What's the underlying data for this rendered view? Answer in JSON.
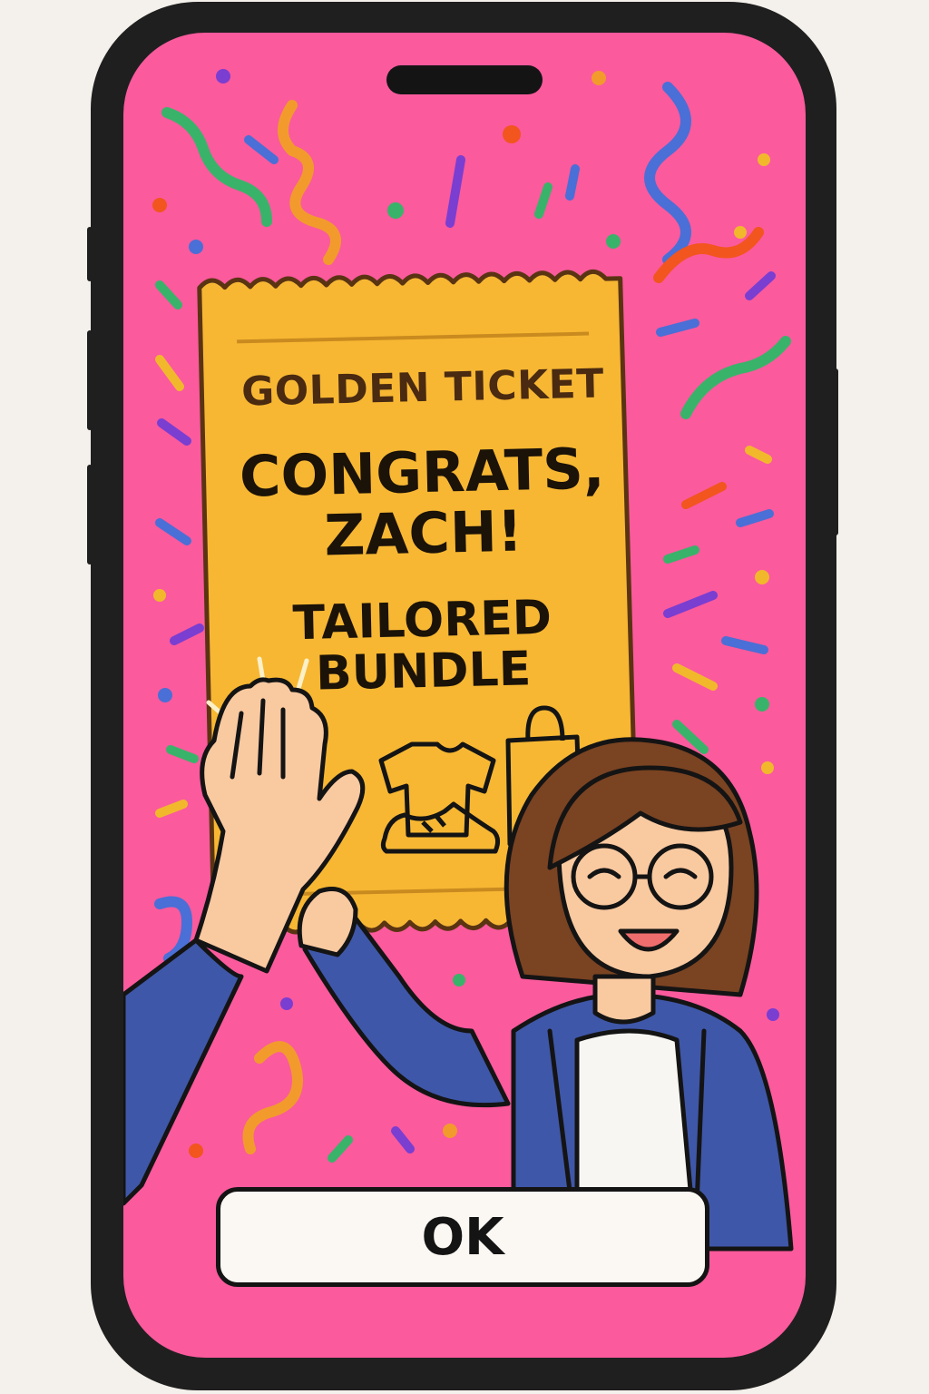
{
  "ticket": {
    "eyebrow": "GOLDEN TICKET",
    "headline_line1": "CONGRATS,",
    "headline_line2": "ZACH!",
    "subhead_line1": "TAILORED",
    "subhead_line2": "BUNDLE"
  },
  "actions": {
    "ok_label": "OK"
  },
  "colors": {
    "background": "#fb5a9d",
    "ticket": "#f7b733",
    "ticket_outline": "#5a3412",
    "button_bg": "#fbf7f3",
    "jacket": "#3f57a8",
    "hair": "#7a4322",
    "skin": "#f9c9a0"
  },
  "icons": [
    "t-shirt-icon",
    "sneaker-icon",
    "shopping-bag-icon",
    "high-five-hand-icon"
  ]
}
